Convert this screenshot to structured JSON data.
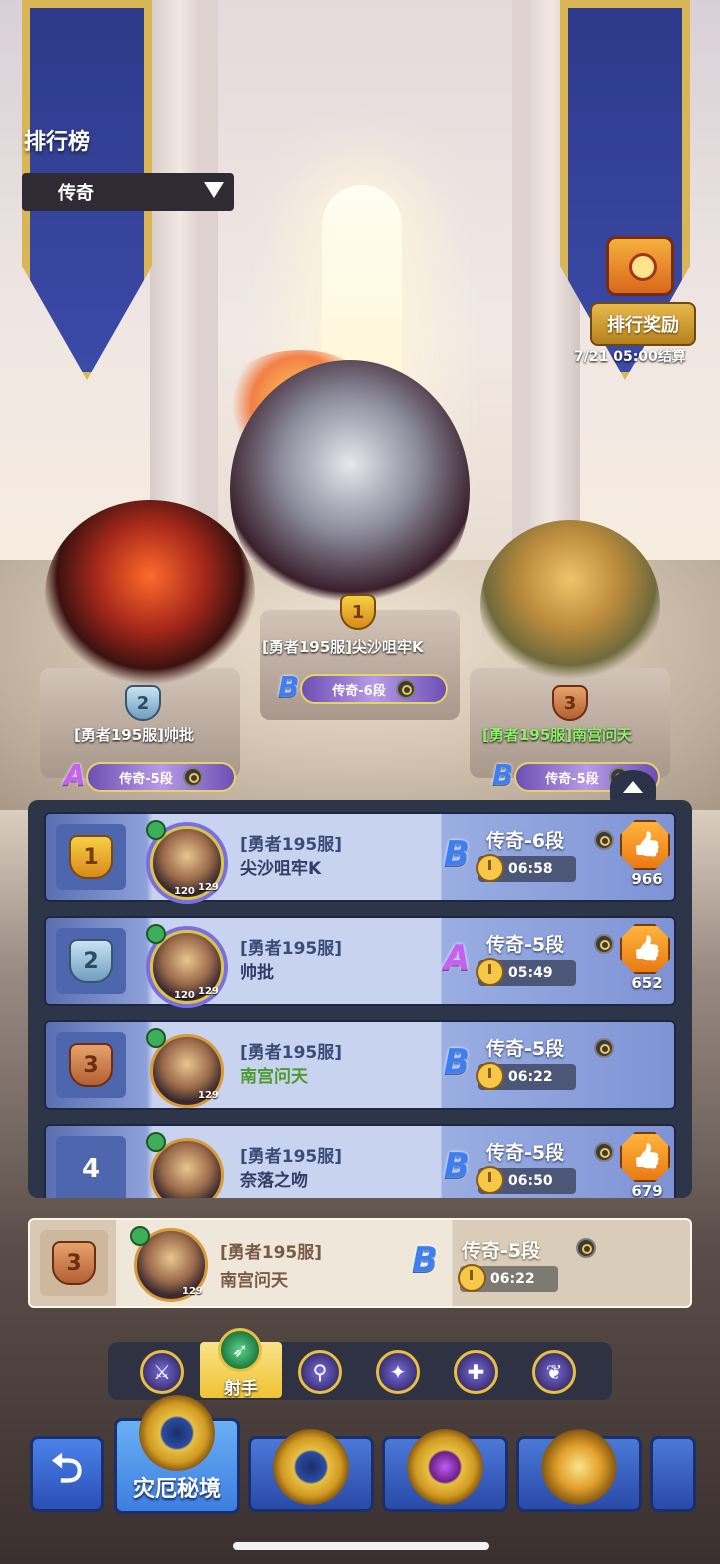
{
  "header": {
    "title": "排行榜",
    "tier_select": "传奇"
  },
  "rewards": {
    "label": "排行奖励",
    "settle_time": "7/21 05:00结算"
  },
  "podium": [
    {
      "rank": "1",
      "name": "[勇者195服]尖沙咀牢K",
      "grade_letter": "B",
      "tier": "传奇-6段"
    },
    {
      "rank": "2",
      "name": "[勇者195服]帅批",
      "grade_letter": "A",
      "tier": "传奇-5段"
    },
    {
      "rank": "3",
      "name": "[勇者195服]南宫问天",
      "grade_letter": "B",
      "tier": "传奇-5段"
    }
  ],
  "list": [
    {
      "rank": "1",
      "server": "[勇者195服]",
      "name": "尖沙咀牢K",
      "grade_letter": "B",
      "tier": "传奇-6段",
      "time": "06:58",
      "likes": "966",
      "level_a": "120",
      "level_b": "129"
    },
    {
      "rank": "2",
      "server": "[勇者195服]",
      "name": "帅批",
      "grade_letter": "A",
      "tier": "传奇-5段",
      "time": "05:49",
      "likes": "652",
      "level_a": "120",
      "level_b": "129"
    },
    {
      "rank": "3",
      "server": "[勇者195服]",
      "name": "南宫问天",
      "grade_letter": "B",
      "tier": "传奇-5段",
      "time": "06:22",
      "likes": "",
      "level_a": "",
      "level_b": "129"
    },
    {
      "rank": "4",
      "server": "[勇者195服]",
      "name": "奈落之吻",
      "grade_letter": "B",
      "tier": "传奇-5段",
      "time": "06:50",
      "likes": "679",
      "level_a": "",
      "level_b": ""
    }
  ],
  "my_rank": {
    "rank": "3",
    "server": "[勇者195服]",
    "name": "南宫问天",
    "grade_letter": "B",
    "tier": "传奇-5段",
    "time": "06:22",
    "level": "129"
  },
  "class_filter": {
    "active_label": "射手",
    "icons": [
      "axe-icon",
      "bow-icon",
      "staff-icon",
      "dagger-icon",
      "shield-icon",
      "spirit-icon"
    ]
  },
  "bottom_nav": {
    "back_icon": "return-icon",
    "active_label": "灾厄秘境"
  },
  "colors": {
    "list_panel": "#2d3548",
    "row_highlight": "#c8d3ef",
    "gold": "#f5c84a",
    "nav_blue": "#2a4aa8"
  }
}
